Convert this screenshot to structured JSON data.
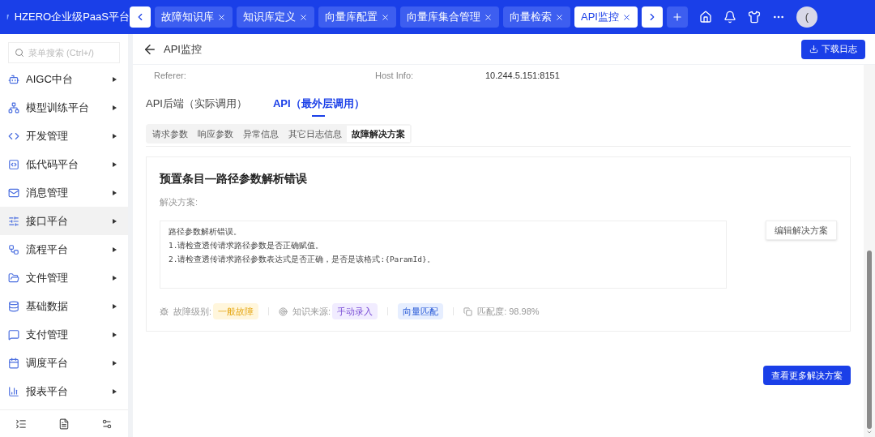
{
  "header": {
    "logo_text": "HZERO企业级PaaS平台",
    "tabs": [
      {
        "label": "故障知识库",
        "selected": false
      },
      {
        "label": "知识库定义",
        "selected": false
      },
      {
        "label": "向量库配置",
        "selected": false
      },
      {
        "label": "向量库集合管理",
        "selected": false
      },
      {
        "label": "向量检索",
        "selected": false
      },
      {
        "label": "API监控",
        "selected": true
      }
    ],
    "avatar_text": "("
  },
  "sidebar": {
    "search": {
      "placeholder": "菜单搜索 (Ctrl+/)"
    },
    "items": [
      {
        "label": "AIGC中台",
        "selected": false
      },
      {
        "label": "模型训练平台",
        "selected": false
      },
      {
        "label": "开发管理",
        "selected": false
      },
      {
        "label": "低代码平台",
        "selected": false
      },
      {
        "label": "消息管理",
        "selected": false
      },
      {
        "label": "接口平台",
        "selected": true
      },
      {
        "label": "流程平台",
        "selected": false
      },
      {
        "label": "文件管理",
        "selected": false
      },
      {
        "label": "基础数据",
        "selected": false
      },
      {
        "label": "支付管理",
        "selected": false
      },
      {
        "label": "调度平台",
        "selected": false
      },
      {
        "label": "报表平台",
        "selected": false
      }
    ]
  },
  "page": {
    "title": "API监控",
    "download_button": "下载日志"
  },
  "info": {
    "referer_label": "Referer:",
    "host_label": "Host Info:",
    "host_value": "10.244.5.151:8151"
  },
  "api_tabs": [
    {
      "label": "API后端（实际调用）",
      "selected": false
    },
    {
      "label": "API（最外层调用）",
      "selected": true
    }
  ],
  "sub_tabs": [
    {
      "label": "请求参数",
      "selected": false
    },
    {
      "label": "响应参数",
      "selected": false
    },
    {
      "label": "异常信息",
      "selected": false
    },
    {
      "label": "其它日志信息",
      "selected": false
    },
    {
      "label": "故障解决方案",
      "selected": true
    }
  ],
  "solution": {
    "title": "预置条目—路径参数解析错误",
    "label": "解决方案:",
    "lines": [
      "路径参数解析错误。",
      "1.请检查透传请求路径参数是否正确赋值。",
      "2.请检查透传请求路径参数表达式是否正确，是否是该格式:{ParamId}。"
    ],
    "edit_button": "编辑解决方案",
    "level_label": "故障级别:",
    "level_tag": {
      "label": "一般故障",
      "kind": "warning"
    },
    "source_label": "知识来源:",
    "source_tag": {
      "label": "手动录入",
      "kind": "source"
    },
    "match_tag": {
      "label": "向量匹配",
      "kind": "match"
    },
    "similarity": "匹配度: 98.98%"
  },
  "more_button": "查看更多解决方案"
}
